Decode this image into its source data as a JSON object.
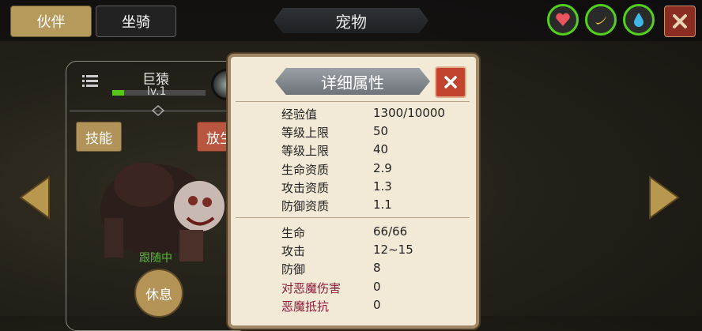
{
  "top": {
    "tab_partner": "伙伴",
    "tab_mount": "坐骑",
    "title": "宠物",
    "icons": [
      "heart-icon",
      "banana-icon",
      "water-drop-icon"
    ]
  },
  "pet": {
    "name": "巨猿",
    "level": "lv.1",
    "xp_fraction": 0.13,
    "btn_skill": "技能",
    "btn_release": "放生",
    "status": "跟随中",
    "btn_rest": "休息"
  },
  "popup": {
    "title": "详细属性",
    "section1": [
      {
        "label": "经验值",
        "value": "1300/10000"
      },
      {
        "label": "等级上限",
        "value": "50"
      },
      {
        "label": "等级上限",
        "value": "40"
      },
      {
        "label": "生命资质",
        "value": "2.9"
      },
      {
        "label": "攻击资质",
        "value": "1.3"
      },
      {
        "label": "防御资质",
        "value": "1.1"
      }
    ],
    "section2": [
      {
        "label": "生命",
        "value": "66/66"
      },
      {
        "label": "攻击",
        "value": "12~15"
      },
      {
        "label": "防御",
        "value": "8"
      },
      {
        "label": "对恶魔伤害",
        "value": "0"
      },
      {
        "label": "恶魔抵抗",
        "value": "0"
      }
    ]
  },
  "colors": {
    "accent_green": "#52d11c",
    "gold_button": "#b19258",
    "red_close": "#c2432e",
    "demon_stat_label": "#8d1b3a"
  }
}
